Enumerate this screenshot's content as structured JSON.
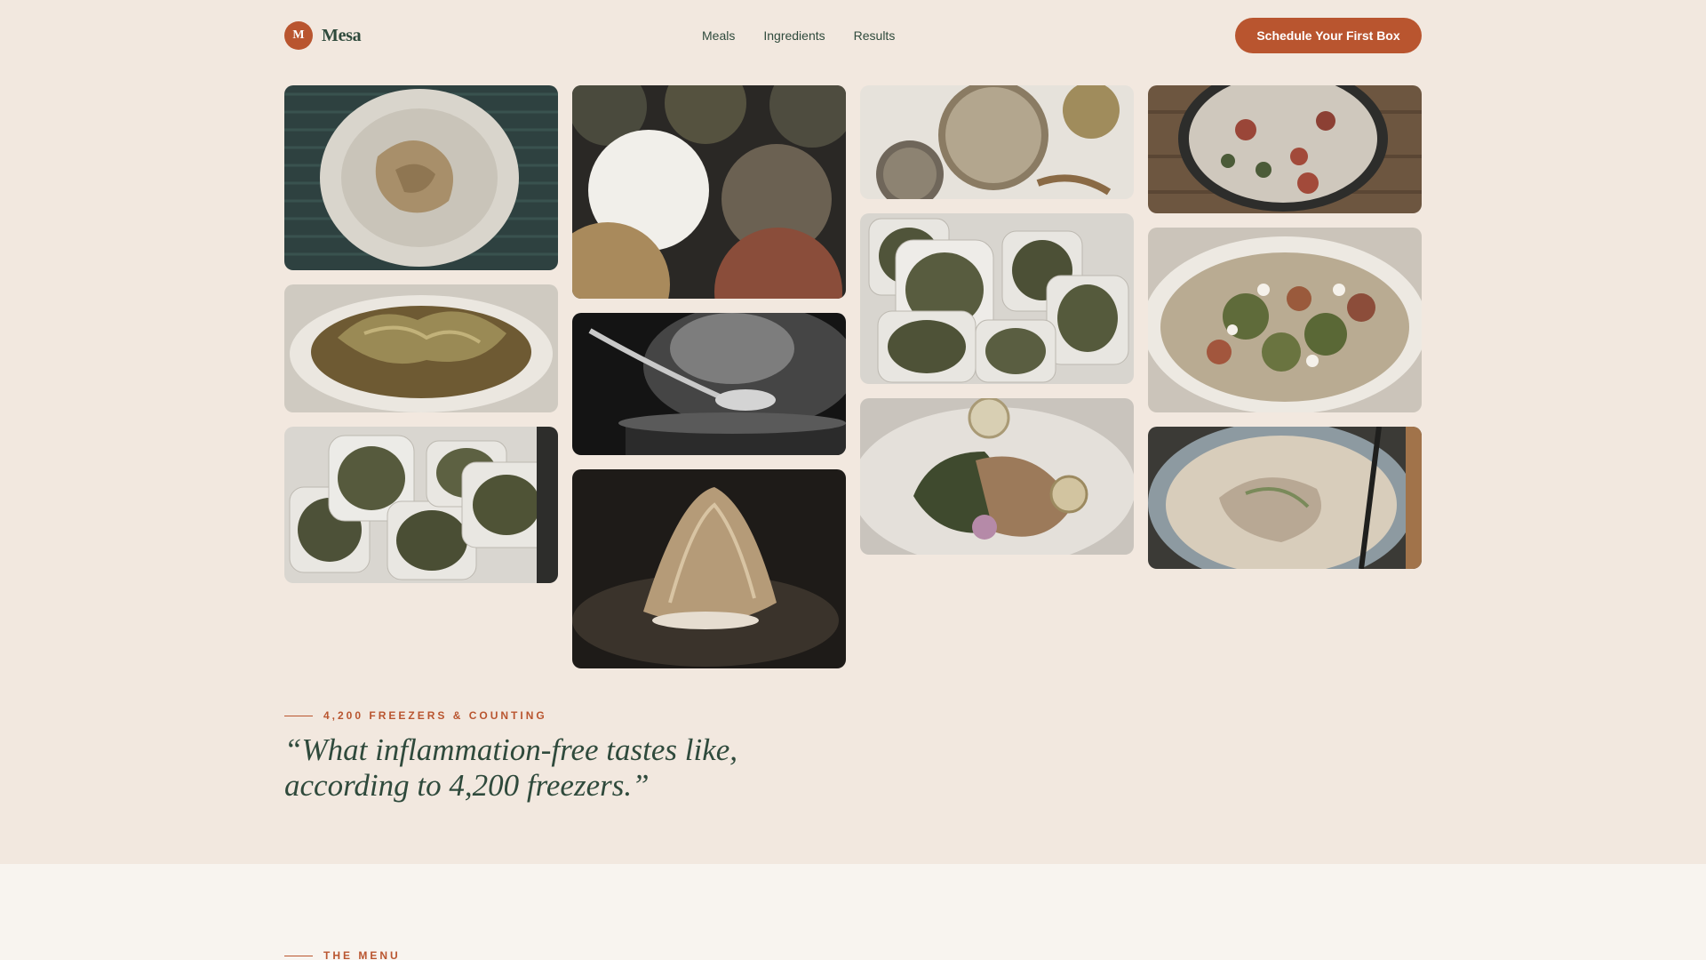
{
  "brand": {
    "mark": "M",
    "name": "Mesa",
    "accent": "#b9552f",
    "text": "#2f4a3c",
    "background": "#f2e8df"
  },
  "nav": {
    "items": [
      "Meals",
      "Ingredients",
      "Results"
    ]
  },
  "cta": {
    "label": "Schedule Your First Box"
  },
  "gallery": {
    "tiles": [
      "spice-powder-bowl-photo",
      "braised-greens-bowl-photo",
      "meal-prep-containers-photo",
      "spice-tins-photo",
      "steaming-pot-photo",
      "plated-dessert-photo",
      "grains-and-seeds-photo",
      "meal-prep-lentils-photo",
      "salmon-citrus-plate-photo",
      "roasted-vegetable-salad-pot-photo",
      "pesto-roasted-vegetables-photo",
      "creamy-grain-bowl-photo"
    ]
  },
  "social_proof": {
    "eyebrow": "4,200 FREEZERS & COUNTING",
    "quote_line1": "“What inflammation-free tastes like,",
    "quote_line2": "according to 4,200 freezers.”"
  },
  "menu_section": {
    "eyebrow": "THE MENU"
  }
}
